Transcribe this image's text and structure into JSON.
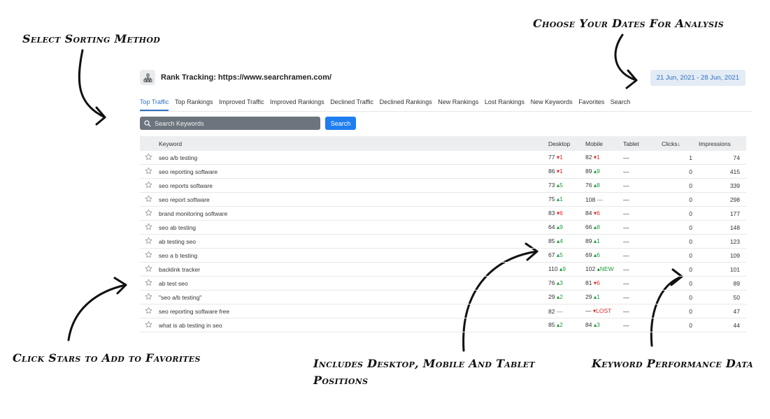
{
  "annotations": {
    "sorting": "Select Sorting Method",
    "dates": "Choose Your Dates For Analysis",
    "stars": "Click Stars to Add to Favorites",
    "devices": "Includes Desktop, Mobile And Tablet Positions",
    "performance": "Keyword Performance Data"
  },
  "header": {
    "icon": "site-structure-icon",
    "title": "Rank Tracking: https://www.searchramen.com/",
    "date_range": "21 Jun, 2021  -  28 Jun, 2021"
  },
  "tabs": [
    {
      "label": "Top Traffic",
      "active": true
    },
    {
      "label": "Top Rankings"
    },
    {
      "label": "Improved Traffic"
    },
    {
      "label": "Improved Rankings"
    },
    {
      "label": "Declined Traffic"
    },
    {
      "label": "Declined Rankings"
    },
    {
      "label": "New Rankings"
    },
    {
      "label": "Lost Rankings"
    },
    {
      "label": "New Keywords"
    },
    {
      "label": "Favorites"
    },
    {
      "label": "Search"
    }
  ],
  "search": {
    "placeholder": "Search Keywords",
    "button_label": "Search",
    "icon": "search-icon"
  },
  "table": {
    "columns": {
      "keyword": "Keyword",
      "desktop": "Desktop",
      "mobile": "Mobile",
      "tablet": "Tablet",
      "clicks": "Clicks↓",
      "impressions": "Impressions"
    },
    "rows": [
      {
        "keyword": "seo a/b testing",
        "desktop": "77",
        "desktop_change": "▾1",
        "desktop_dir": "down",
        "mobile": "82",
        "mobile_change": "▾1",
        "mobile_dir": "down",
        "tablet": "—",
        "clicks": "1",
        "impressions": "74"
      },
      {
        "keyword": "seo reporting software",
        "desktop": "86",
        "desktop_change": "▾1",
        "desktop_dir": "down",
        "mobile": "89",
        "mobile_change": "▴9",
        "mobile_dir": "up",
        "tablet": "—",
        "clicks": "0",
        "impressions": "415"
      },
      {
        "keyword": "seo reports software",
        "desktop": "73",
        "desktop_change": "▴5",
        "desktop_dir": "up",
        "mobile": "76",
        "mobile_change": "▴8",
        "mobile_dir": "up",
        "tablet": "—",
        "clicks": "0",
        "impressions": "339"
      },
      {
        "keyword": "seo report software",
        "desktop": "75",
        "desktop_change": "▴1",
        "desktop_dir": "up",
        "mobile": "108",
        "mobile_change": "—",
        "mobile_dir": "dash",
        "tablet": "—",
        "clicks": "0",
        "impressions": "298"
      },
      {
        "keyword": "brand monitoring software",
        "desktop": "83",
        "desktop_change": "▾6",
        "desktop_dir": "down",
        "mobile": "84",
        "mobile_change": "▾6",
        "mobile_dir": "down",
        "tablet": "—",
        "clicks": "0",
        "impressions": "177"
      },
      {
        "keyword": "seo ab testing",
        "desktop": "64",
        "desktop_change": "▴9",
        "desktop_dir": "up",
        "mobile": "66",
        "mobile_change": "▴8",
        "mobile_dir": "up",
        "tablet": "—",
        "clicks": "0",
        "impressions": "148"
      },
      {
        "keyword": "ab testing seo",
        "desktop": "85",
        "desktop_change": "▴4",
        "desktop_dir": "up",
        "mobile": "89",
        "mobile_change": "▴1",
        "mobile_dir": "up",
        "tablet": "—",
        "clicks": "0",
        "impressions": "123"
      },
      {
        "keyword": "seo a b testing",
        "desktop": "67",
        "desktop_change": "▴5",
        "desktop_dir": "up",
        "mobile": "69",
        "mobile_change": "▴6",
        "mobile_dir": "up",
        "tablet": "—",
        "clicks": "0",
        "impressions": "109"
      },
      {
        "keyword": "backlink tracker",
        "desktop": "110",
        "desktop_change": "▴9",
        "desktop_dir": "up",
        "mobile": "102",
        "mobile_change": "▴NEW",
        "mobile_dir": "up",
        "tablet": "—",
        "clicks": "0",
        "impressions": "101"
      },
      {
        "keyword": "ab test seo",
        "desktop": "76",
        "desktop_change": "▴3",
        "desktop_dir": "up",
        "mobile": "81",
        "mobile_change": "▾6",
        "mobile_dir": "down",
        "tablet": "—",
        "clicks": "0",
        "impressions": "89"
      },
      {
        "keyword": "\"seo a/b testing\"",
        "desktop": "29",
        "desktop_change": "▴2",
        "desktop_dir": "up",
        "mobile": "29",
        "mobile_change": "▴1",
        "mobile_dir": "up",
        "tablet": "—",
        "clicks": "0",
        "impressions": "50"
      },
      {
        "keyword": "seo reporting software free",
        "desktop": "82",
        "desktop_change": "—",
        "desktop_dir": "dash",
        "mobile": "—",
        "mobile_change": "▾LOST",
        "mobile_dir": "down",
        "tablet": "—",
        "clicks": "0",
        "impressions": "47"
      },
      {
        "keyword": "what is ab testing in seo",
        "desktop": "85",
        "desktop_change": "▴2",
        "desktop_dir": "up",
        "mobile": "84",
        "mobile_change": "▴3",
        "mobile_dir": "up",
        "tablet": "—",
        "clicks": "0",
        "impressions": "44"
      }
    ]
  },
  "colors": {
    "accent": "#2f72c4",
    "button": "#1e7ef0",
    "up": "#1e9a3e",
    "down": "#e02828",
    "search_bg": "#6c757d"
  }
}
